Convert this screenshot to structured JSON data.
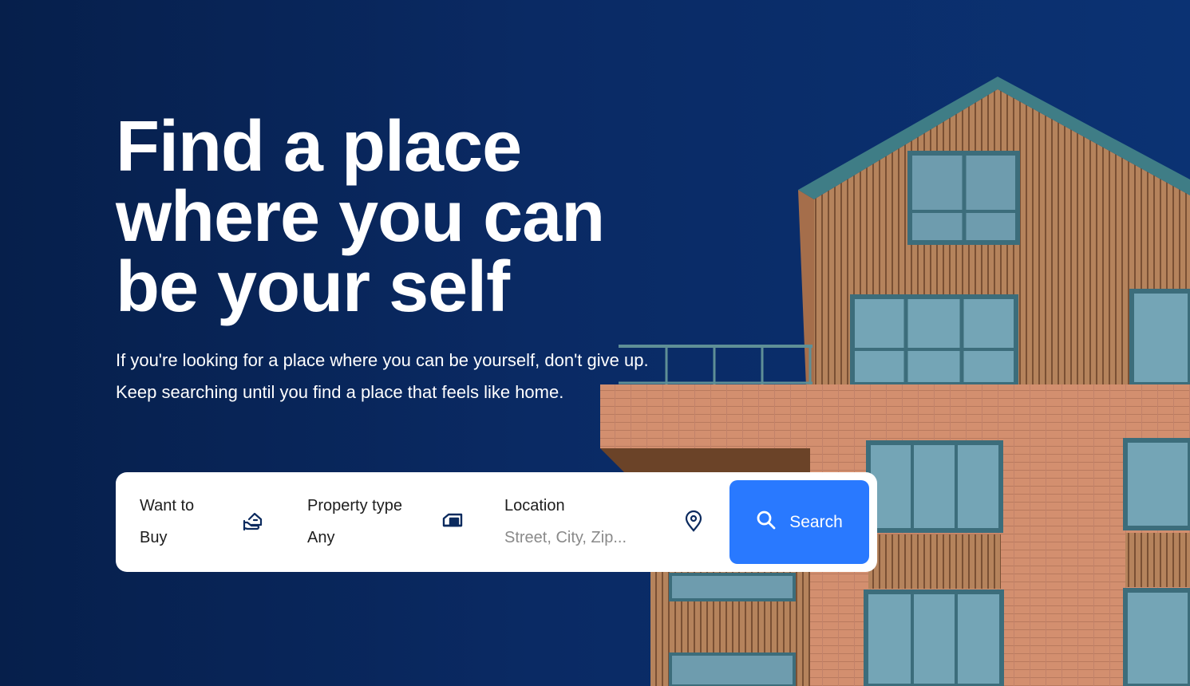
{
  "hero": {
    "headline_lines": [
      "Find a place",
      "where you can",
      "be your self"
    ],
    "subtext": "If you're looking for a place where you can be yourself, don't give up. Keep searching until you find a place that feels like home."
  },
  "search": {
    "want_to": {
      "label": "Want to",
      "value": "Buy",
      "icon": "hand-house-icon"
    },
    "property_type": {
      "label": "Property type",
      "value": "Any",
      "icon": "house-icon"
    },
    "location": {
      "label": "Location",
      "placeholder": "Street, City, Zip...",
      "icon": "map-pin-icon"
    },
    "button": {
      "label": "Search",
      "icon": "search-icon"
    }
  },
  "colors": {
    "background": "#0a2a64",
    "accent": "#2979ff",
    "text_on_dark": "#ffffff",
    "icon": "#0b2a5e"
  }
}
